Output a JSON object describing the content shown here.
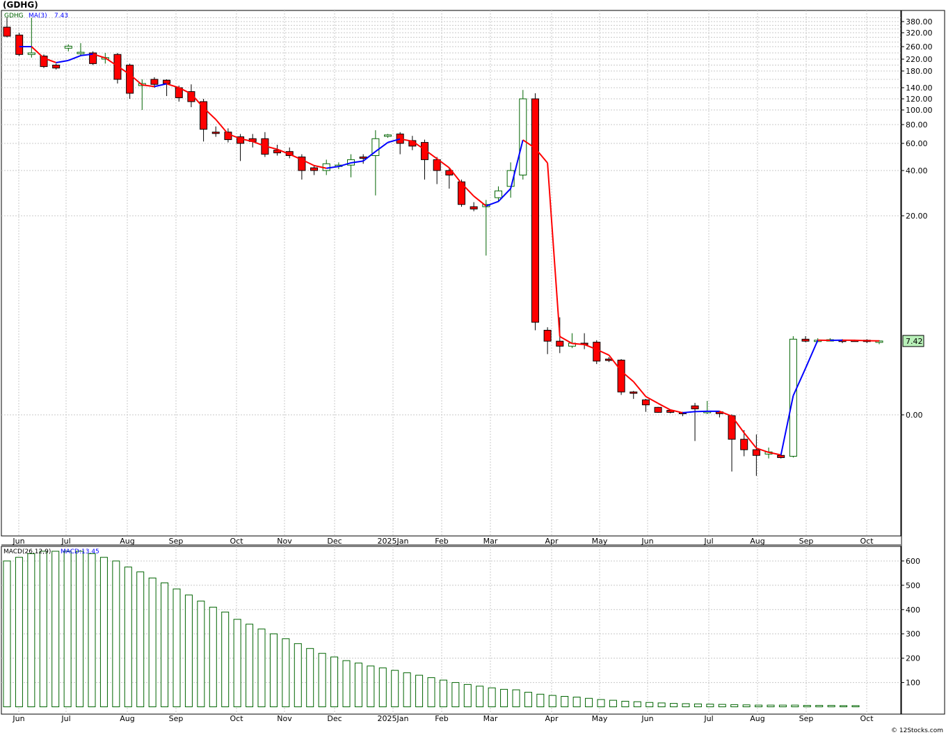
{
  "header": {
    "symbol": "(GDHG)"
  },
  "legend_top": {
    "symbol": "GDHG",
    "ma_label": "MA(3)",
    "ma_value": "7.43"
  },
  "legend_bottom": {
    "macd_label": "MACD(26,12,9)",
    "macd_value": "MACD:13.45"
  },
  "last_price_tag": "7.42",
  "credit": "© 12Stocks.com",
  "colors": {
    "up": "#006400",
    "down": "#ff0000",
    "ma_up": "#0000ff",
    "ma_down": "#ff0000",
    "macd": "#006400",
    "tag_bg": "#b8f0b8",
    "grid": "#c8c8c8"
  },
  "chart_data": [
    {
      "type": "candlestick",
      "title": "(GDHG)",
      "scale": "log-ish",
      "y_ticks": [
        "380.00",
        "320.00",
        "260.00",
        "220.00",
        "180.00",
        "140.00",
        "120.00",
        "100.00",
        "80.00",
        "60.00",
        "40.00",
        "20.00",
        "0.00"
      ],
      "x_ticks": [
        "Jun",
        "Jul",
        "Aug",
        "Sep",
        "Oct",
        "Nov",
        "Dec",
        "2025Jan",
        "Feb",
        "Mar",
        "Apr",
        "May",
        "Jun",
        "Jul",
        "Aug",
        "Sep",
        "Oct"
      ],
      "candles": [
        {
          "o": 350,
          "h": 400,
          "l": 300,
          "c": 305
        },
        {
          "o": 310,
          "h": 320,
          "l": 230,
          "c": 235
        },
        {
          "o": 235,
          "h": 400,
          "l": 225,
          "c": 240
        },
        {
          "o": 230,
          "h": 235,
          "l": 190,
          "c": 195
        },
        {
          "o": 200,
          "h": 205,
          "l": 185,
          "c": 190
        },
        {
          "o": 255,
          "h": 270,
          "l": 245,
          "c": 262
        },
        {
          "o": 240,
          "h": 275,
          "l": 230,
          "c": 242
        },
        {
          "o": 240,
          "h": 245,
          "l": 200,
          "c": 205
        },
        {
          "o": 220,
          "h": 240,
          "l": 205,
          "c": 225
        },
        {
          "o": 235,
          "h": 240,
          "l": 150,
          "c": 160
        },
        {
          "o": 200,
          "h": 205,
          "l": 120,
          "c": 130
        },
        {
          "o": 145,
          "h": 160,
          "l": 100,
          "c": 150
        },
        {
          "o": 160,
          "h": 165,
          "l": 140,
          "c": 148
        },
        {
          "o": 158,
          "h": 160,
          "l": 125,
          "c": 150
        },
        {
          "o": 140,
          "h": 145,
          "l": 115,
          "c": 122
        },
        {
          "o": 133,
          "h": 148,
          "l": 105,
          "c": 115
        },
        {
          "o": 115,
          "h": 120,
          "l": 62,
          "c": 75
        },
        {
          "o": 72,
          "h": 78,
          "l": 67,
          "c": 71
        },
        {
          "o": 72,
          "h": 76,
          "l": 61,
          "c": 64
        },
        {
          "o": 67,
          "h": 70,
          "l": 47,
          "c": 60
        },
        {
          "o": 65,
          "h": 70,
          "l": 57,
          "c": 62
        },
        {
          "o": 65,
          "h": 72,
          "l": 50,
          "c": 52
        },
        {
          "o": 55,
          "h": 59,
          "l": 51,
          "c": 53
        },
        {
          "o": 54,
          "h": 57,
          "l": 49,
          "c": 51
        },
        {
          "o": 50,
          "h": 52,
          "l": 36,
          "c": 40
        },
        {
          "o": 42,
          "h": 44,
          "l": 38,
          "c": 40
        },
        {
          "o": 40,
          "h": 48,
          "l": 38,
          "c": 45
        },
        {
          "o": 43,
          "h": 46,
          "l": 41,
          "c": 44
        },
        {
          "o": 44,
          "h": 52,
          "l": 37,
          "c": 48
        },
        {
          "o": 50,
          "h": 52,
          "l": 45,
          "c": 49
        },
        {
          "o": 51,
          "h": 74,
          "l": 29,
          "c": 65
        },
        {
          "o": 68,
          "h": 70,
          "l": 66,
          "c": 69
        },
        {
          "o": 70,
          "h": 72,
          "l": 52,
          "c": 60
        },
        {
          "o": 63,
          "h": 68,
          "l": 55,
          "c": 58
        },
        {
          "o": 61,
          "h": 64,
          "l": 36,
          "c": 48
        },
        {
          "o": 48,
          "h": 50,
          "l": 34,
          "c": 40
        },
        {
          "o": 40,
          "h": 42,
          "l": 32,
          "c": 38
        },
        {
          "o": 35,
          "h": 36,
          "l": 24,
          "c": 25
        },
        {
          "o": 24,
          "h": 26,
          "l": 22,
          "c": 23
        },
        {
          "o": 24,
          "h": 27,
          "l": 16,
          "c": 25
        },
        {
          "o": 28,
          "h": 33,
          "l": 26,
          "c": 31
        },
        {
          "o": 33,
          "h": 46,
          "l": 28,
          "c": 40
        },
        {
          "o": 38,
          "h": 136,
          "l": 36,
          "c": 120
        },
        {
          "o": 120,
          "h": 130,
          "l": 8.5,
          "c": 9.3
        },
        {
          "o": 8.5,
          "h": 8.8,
          "l": 6.1,
          "c": 7.4
        },
        {
          "o": 7.4,
          "h": 9.8,
          "l": 6.2,
          "c": 6.9
        },
        {
          "o": 6.9,
          "h": 8.2,
          "l": 6.7,
          "c": 7.2
        },
        {
          "o": 7.2,
          "h": 8.2,
          "l": 6.6,
          "c": 7.1
        },
        {
          "o": 7.3,
          "h": 7.5,
          "l": 5.1,
          "c": 5.4
        },
        {
          "o": 5.6,
          "h": 5.8,
          "l": 5.3,
          "c": 5.5
        },
        {
          "o": 5.5,
          "h": 5.6,
          "l": 2.0,
          "c": 2.3
        },
        {
          "o": 2.3,
          "h": 2.4,
          "l": 1.6,
          "c": 2.2
        },
        {
          "o": 1.5,
          "h": 1.6,
          "l": 0.3,
          "c": 1.0
        },
        {
          "o": 0.75,
          "h": 0.8,
          "l": 0.2,
          "c": 0.25
        },
        {
          "o": 0.45,
          "h": 0.5,
          "l": 0.15,
          "c": 0.25
        },
        {
          "o": 0.25,
          "h": 0.3,
          "l": -0.03,
          "c": 0.12
        },
        {
          "o": 0.9,
          "h": 1.2,
          "l": -0.6,
          "c": 0.6
        },
        {
          "o": 0.25,
          "h": 1.4,
          "l": 0.08,
          "c": 0.35
        },
        {
          "o": 0.3,
          "h": 0.4,
          "l": -0.06,
          "c": 0.12
        },
        {
          "o": -0.02,
          "h": 0.05,
          "l": -1.3,
          "c": -0.56
        },
        {
          "o": -0.56,
          "h": -0.35,
          "l": -0.95,
          "c": -0.8
        },
        {
          "o": -0.8,
          "h": -0.45,
          "l": -1.4,
          "c": -0.93
        },
        {
          "o": -0.9,
          "h": -0.75,
          "l": -1.0,
          "c": -0.85
        },
        {
          "o": -0.93,
          "h": -0.92,
          "l": -1.0,
          "c": -0.98
        },
        {
          "o": -0.95,
          "h": 7.9,
          "l": -0.98,
          "c": 7.6
        },
        {
          "o": 7.6,
          "h": 7.9,
          "l": 7.3,
          "c": 7.4
        },
        {
          "o": 7.5,
          "h": 7.7,
          "l": 7.3,
          "c": 7.5
        },
        {
          "o": 7.5,
          "h": 7.7,
          "l": 7.4,
          "c": 7.55
        },
        {
          "o": 7.5,
          "h": 7.6,
          "l": 7.2,
          "c": 7.45
        },
        {
          "o": 7.5,
          "h": 7.55,
          "l": 7.4,
          "c": 7.48
        },
        {
          "o": 7.5,
          "h": 7.6,
          "l": 7.2,
          "c": 7.4
        },
        {
          "o": 7.38,
          "h": 7.5,
          "l": 7.1,
          "c": 7.42
        }
      ]
    },
    {
      "type": "bar",
      "title": "MACD(26,12,9)",
      "y_ticks": [
        "600",
        "500",
        "400",
        "300",
        "200",
        "100"
      ],
      "ylim": [
        -30,
        660
      ],
      "values": [
        600,
        615,
        630,
        640,
        640,
        640,
        640,
        630,
        615,
        600,
        575,
        555,
        530,
        510,
        485,
        460,
        435,
        410,
        390,
        360,
        340,
        320,
        300,
        280,
        260,
        240,
        220,
        205,
        190,
        180,
        168,
        160,
        150,
        140,
        130,
        120,
        110,
        100,
        92,
        85,
        78,
        72,
        70,
        60,
        52,
        47,
        43,
        40,
        35,
        30,
        27,
        23,
        21,
        18,
        16,
        14,
        13,
        12,
        11,
        10,
        9,
        8,
        7,
        7,
        7,
        7,
        6,
        6,
        6,
        5,
        5
      ]
    }
  ]
}
